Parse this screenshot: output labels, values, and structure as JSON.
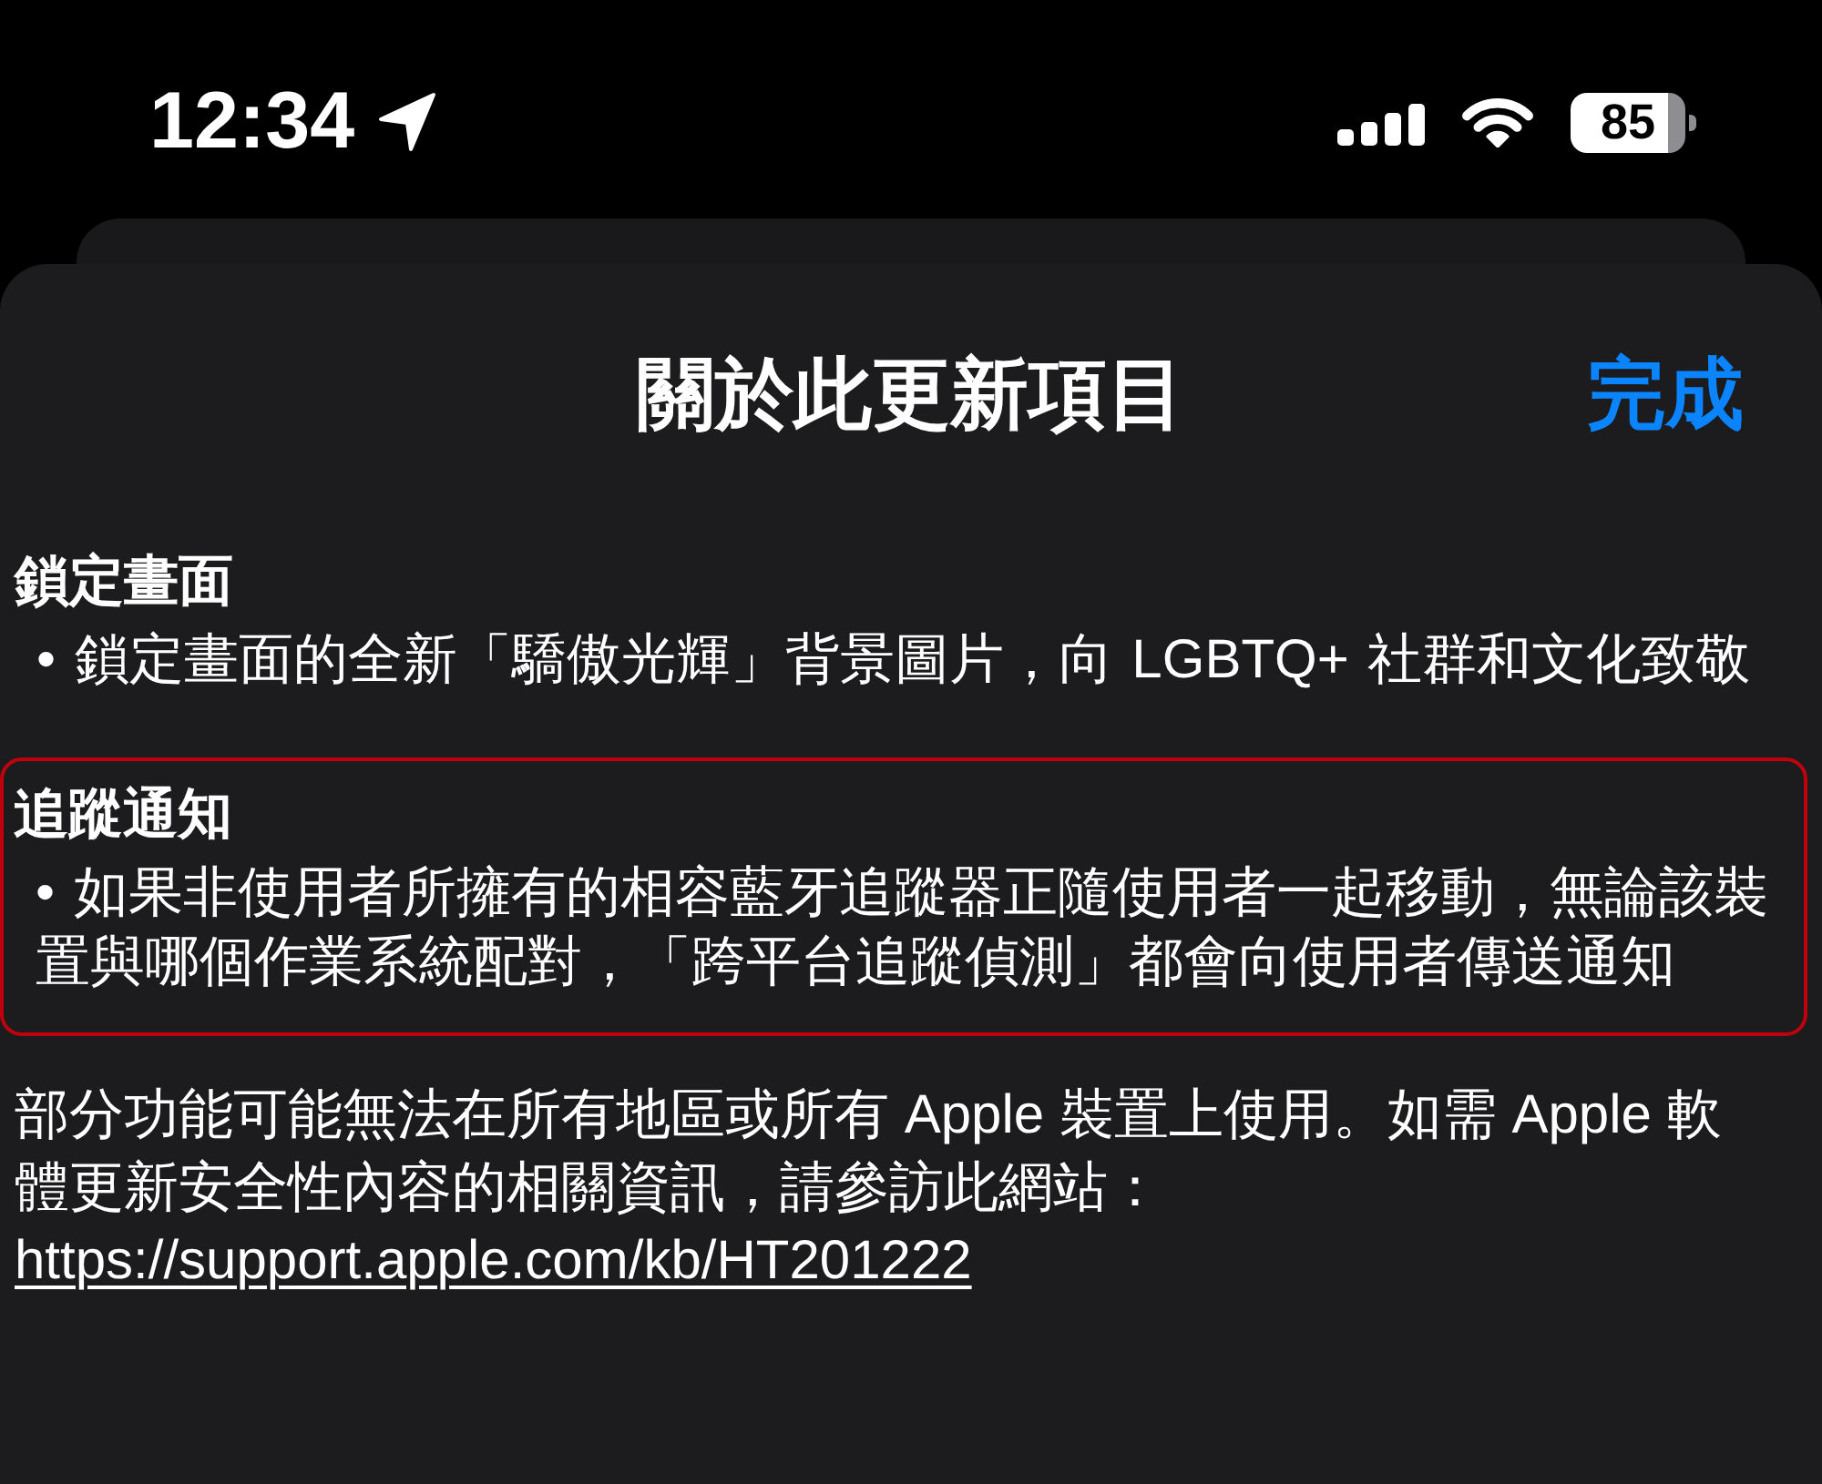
{
  "status_bar": {
    "time": "12:34",
    "battery": "85"
  },
  "sheet": {
    "title": "關於此更新項目",
    "done_button": "完成"
  },
  "sections": [
    {
      "heading": "鎖定畫面",
      "highlighted": false,
      "bullets": [
        "• 鎖定畫面的全新「驕傲光輝」背景圖片，向 LGBTQ+ 社群和文化致敬"
      ]
    },
    {
      "heading": "追蹤通知",
      "highlighted": true,
      "bullets": [
        "• 如果非使用者所擁有的相容藍牙追蹤器正隨使用者一起移動，無論該裝置與哪個作業系統配對，「跨平台追蹤偵測」都會向使用者傳送通知"
      ]
    }
  ],
  "footer_note": {
    "text": "部分功能可能無法在所有地區或所有 Apple 裝置上使用。如需 Apple 軟體更新安全性內容的相關資訊，請參訪此網站：",
    "link": "https://support.apple.com/kb/HT201222"
  }
}
